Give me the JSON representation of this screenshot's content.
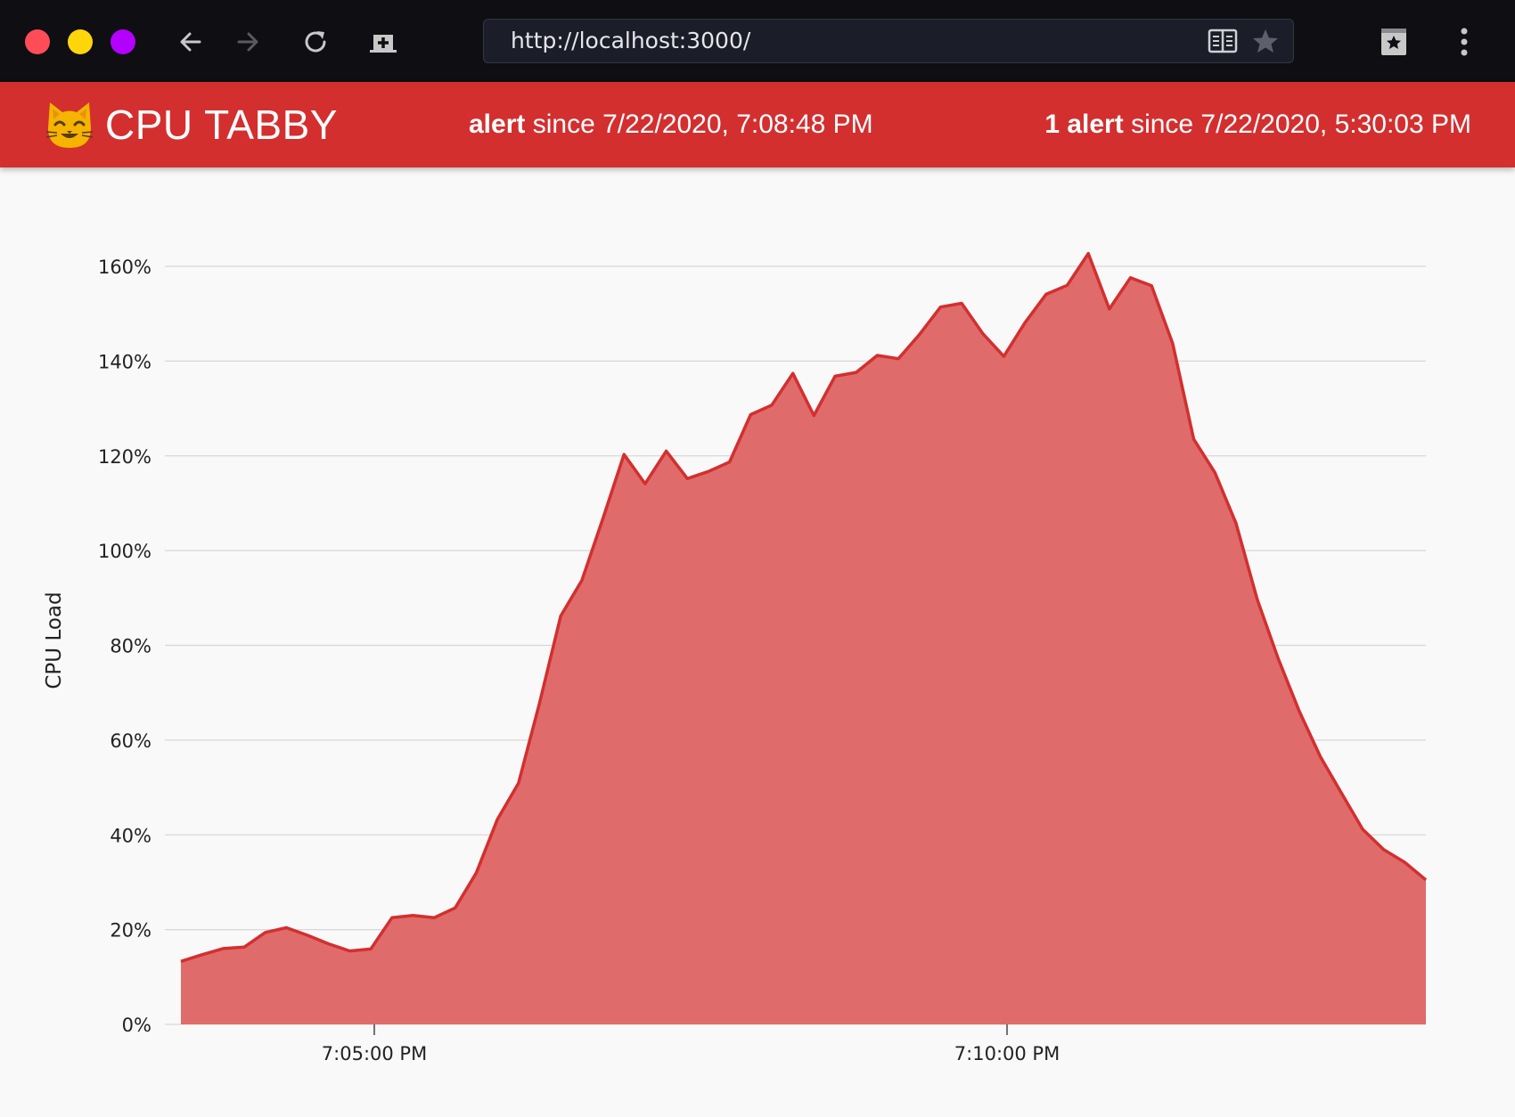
{
  "browser": {
    "url": "http://localhost:3000/",
    "traffic_lights": {
      "close": "#ff4d58",
      "minimize": "#ffd60a",
      "zoom": "#b400ff"
    },
    "icons": [
      "back-arrow-icon",
      "forward-arrow-icon",
      "reload-icon",
      "new-tab-icon",
      "reader-mode-icon",
      "bookmark-star-icon",
      "bookmarks-icon",
      "kebab-menu-icon"
    ]
  },
  "header": {
    "logo": "cat-face-emoji",
    "title": "CPU TABBY",
    "alert_status": {
      "label": "alert",
      "since": "since 7/22/2020, 7:08:48 PM"
    },
    "alert_count": {
      "label": "1 alert",
      "since": "since 7/22/2020, 5:30:03 PM"
    },
    "background_color": "#d32f2f"
  },
  "chart_data": {
    "type": "area",
    "title": "",
    "xlabel": "",
    "ylabel": "CPU Load",
    "y_ticks": [
      "0%",
      "20%",
      "40%",
      "60%",
      "80%",
      "100%",
      "120%",
      "140%",
      "160%"
    ],
    "ylim": [
      0,
      160
    ],
    "x_ticks": [
      {
        "label": "7:05:00 PM",
        "minutes": 0
      },
      {
        "label": "7:10:00 PM",
        "minutes": 5
      }
    ],
    "grid": true,
    "fill_color": "#e06b6b",
    "line_color": "#d32f2f",
    "series": [
      {
        "values": [
          13.3,
          14.7,
          16.0,
          16.3,
          19.4,
          20.4,
          18.8,
          17.0,
          15.5,
          15.9,
          22.5,
          23.0,
          22.5,
          24.6,
          32.0,
          43.3,
          50.9,
          67.9,
          86.2,
          93.7,
          106.8,
          120.3,
          114.1,
          121.0,
          115.2,
          116.7,
          118.7,
          128.7,
          130.7,
          137.4,
          128.5,
          136.8,
          137.6,
          141.2,
          140.5,
          145.6,
          151.4,
          152.2,
          145.8,
          141.0,
          148.1,
          154.1,
          156.0,
          162.7,
          151.0,
          157.6,
          155.9,
          143.7,
          123.5,
          116.5,
          105.8,
          89.8,
          77.2,
          66.1,
          56.5,
          48.8,
          41.2,
          36.9,
          34.2,
          30.5
        ]
      }
    ]
  }
}
